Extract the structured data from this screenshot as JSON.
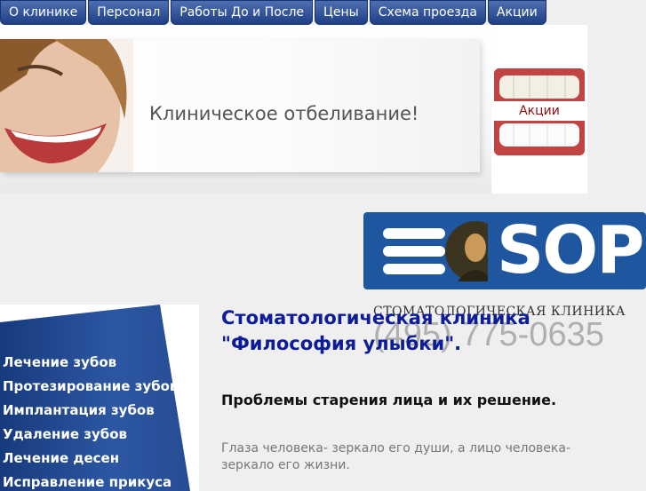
{
  "nav": {
    "items": [
      "О клинике",
      "Персонал",
      "Работы До и После",
      "Цены",
      "Схема проезда",
      "Акции"
    ]
  },
  "banner": {
    "headline": "Клиническое отбеливание!",
    "promo_label": "Акции"
  },
  "logo": {
    "name": "SOPHI",
    "subtitle": "СТОМАТОЛОГИЧЕСКАЯ КЛИНИКА",
    "phone": "(495) 775-0635"
  },
  "sidebar": {
    "items": [
      "Лечение зубов",
      "Протезирование зубов",
      "Имплантация зубов",
      "Удаление зубов",
      "Лечение десен",
      "Исправление прикуса"
    ]
  },
  "main": {
    "title_line1": "Стоматологическая клиника",
    "title_line2": "\"Философия улыбки\".",
    "subtitle": "Проблемы старения лица и их решение.",
    "quote": "Глаза человека- зеркало его души, а лицо человека- зеркало его жизни."
  },
  "colors": {
    "nav": "#2a4a92",
    "title": "#0d1c99",
    "logo_bg": "#1f56a0"
  }
}
